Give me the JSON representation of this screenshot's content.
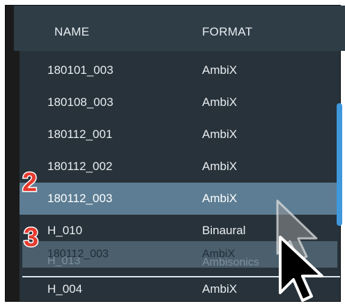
{
  "header": {
    "name_label": "NAME",
    "format_label": "FORMAT"
  },
  "rows": [
    {
      "name": "180101_003",
      "format": "AmbiX"
    },
    {
      "name": "180108_003",
      "format": "AmbiX"
    },
    {
      "name": "180112_001",
      "format": "AmbiX"
    },
    {
      "name": "180112_002",
      "format": "AmbiX"
    },
    {
      "name": "180112_003",
      "format": "AmbiX",
      "selected": true
    },
    {
      "name": "H_010",
      "format": "Binaural"
    },
    {
      "name": "H_013",
      "format": "Ambisonics"
    },
    {
      "name": "H_004",
      "format": "AmbiX"
    }
  ],
  "drag_ghost": {
    "name": "180112_003",
    "format": "AmbiX"
  },
  "annotations": {
    "step_2": "2",
    "step_3": "3"
  },
  "colors": {
    "accent": "#3f97dc",
    "selected_row": "#5c7d93",
    "badge": "#e63a2e",
    "header_bg": "#2f3d47",
    "list_bg": "#27323a"
  },
  "icons": {
    "cursor": "arrow-cursor-icon",
    "drag_cursor": "arrow-cursor-ghost-icon"
  }
}
